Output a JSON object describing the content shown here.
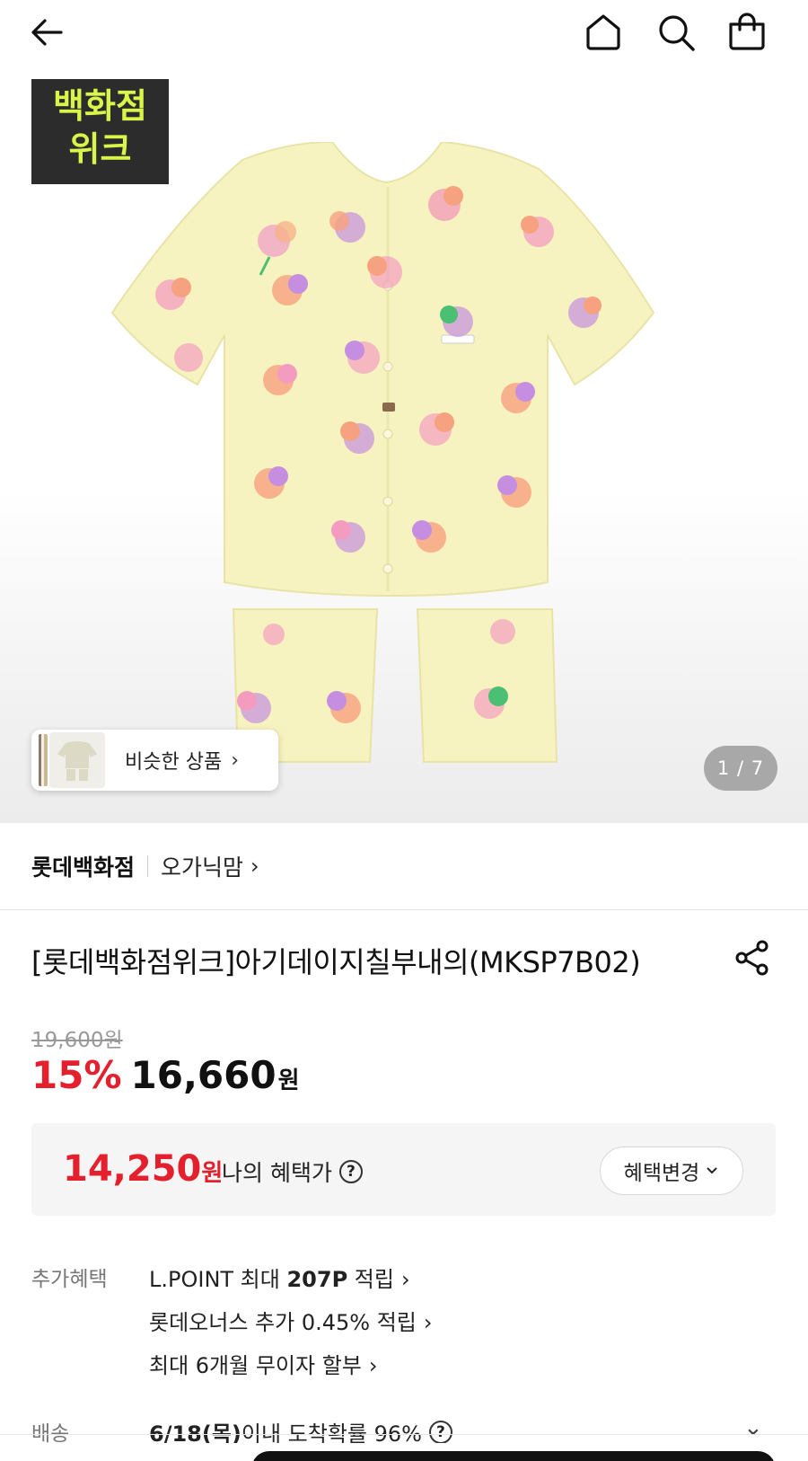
{
  "header": {
    "back_icon": "arrow-left-icon",
    "home_icon": "home-icon",
    "search_icon": "search-icon",
    "cart_icon": "shopping-bag-icon"
  },
  "hero": {
    "badge_line1": "백화점",
    "badge_line2": "위크",
    "similar_label": "비슷한 상품",
    "similar_chevron": "›",
    "image_counter": "1 / 7"
  },
  "brand": {
    "store": "롯데백화점",
    "brand_name": "오가닉맘",
    "chevron": "›"
  },
  "product": {
    "title": "[롯데백화점위크]아기데이지칠부내의(MKSP7B02)",
    "original_price": "19,600원",
    "discount": "15%",
    "price": "16,660",
    "price_unit": "원"
  },
  "benefit": {
    "price": "14,250",
    "unit": "원",
    "label": "나의 혜택가",
    "help": "?",
    "change_button": "혜택변경"
  },
  "extra_benefits": {
    "label": "추가혜택",
    "items": [
      {
        "prefix": "L.POINT 최대 ",
        "bold": "207P",
        "suffix": " 적립"
      },
      {
        "text": "롯데오너스 추가 0.45% 적립"
      },
      {
        "text": "최대 6개월 무이자 할부"
      }
    ]
  },
  "shipping": {
    "label": "배송",
    "date": "6/18(목)",
    "text": " 이내 도착확률 96%",
    "help": "?"
  },
  "colors": {
    "accent_red": "#e5202e",
    "badge_bg": "#2c2c2c",
    "badge_text": "#d9f54a",
    "garment": "#f7f3c0"
  }
}
